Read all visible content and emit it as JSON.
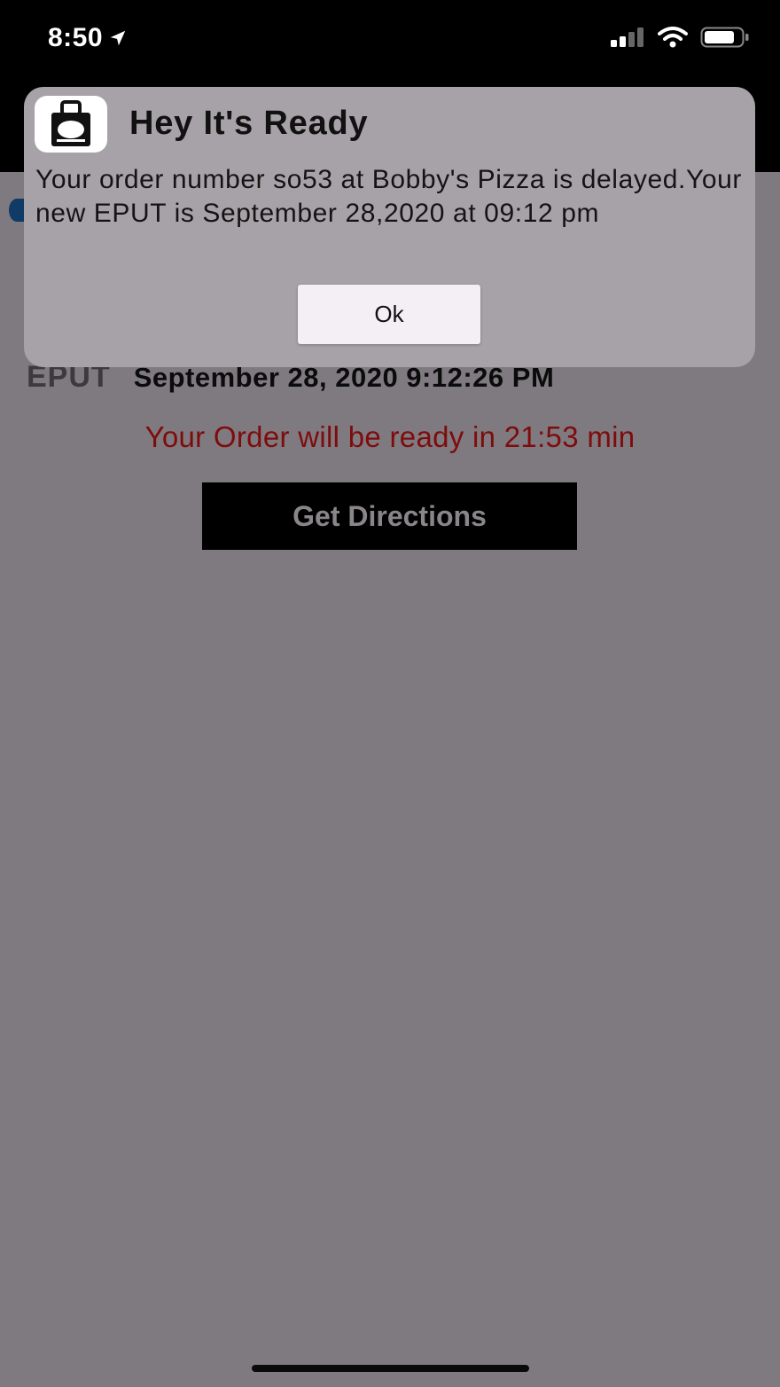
{
  "status_bar": {
    "time": "8:50",
    "icons": [
      "location-arrow-icon",
      "cellular-signal-icon",
      "wifi-icon",
      "battery-icon"
    ]
  },
  "background": {
    "eput_label": "EPUT",
    "eput_value": "September 28, 2020 9:12:26 PM",
    "ready_message": "Your Order will be ready in 21:53 min",
    "directions_button": "Get Directions"
  },
  "dialog": {
    "title": "Hey It's Ready",
    "message": "Your order number so53 at Bobby's Pizza is delayed.Your new EPUT is September 28,2020 at 09:12 pm",
    "ok_button": "Ok",
    "icon": "hey-bag-logo-icon"
  },
  "colors": {
    "ready_text": "#7e0c0c",
    "overlay_background": "#7f7a80",
    "dialog_background": "#a7a2a7",
    "directions_button_background": "#000000"
  }
}
